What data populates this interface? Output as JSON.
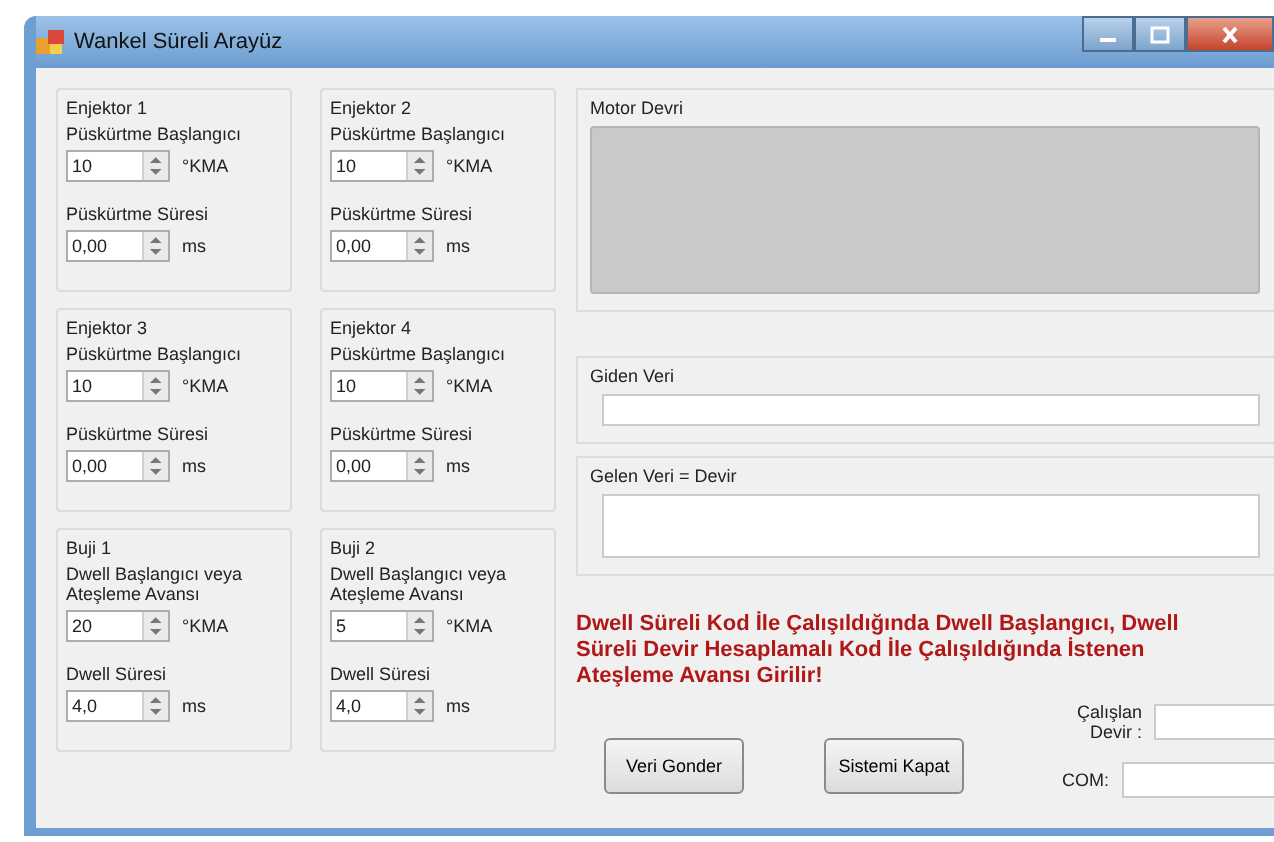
{
  "window": {
    "title": "Wankel Süreli Arayüz"
  },
  "groups": [
    {
      "title": "Enjektor 1",
      "fields": [
        {
          "label": "Püskürtme Başlangıcı",
          "value": "10",
          "unit": "°KMA"
        },
        {
          "label": "Püskürtme Süresi",
          "value": "0,00",
          "unit": "ms"
        }
      ]
    },
    {
      "title": "Enjektor 2",
      "fields": [
        {
          "label": "Püskürtme Başlangıcı",
          "value": "10",
          "unit": "°KMA"
        },
        {
          "label": "Püskürtme Süresi",
          "value": "0,00",
          "unit": "ms"
        }
      ]
    },
    {
      "title": "Enjektor 3",
      "fields": [
        {
          "label": "Püskürtme Başlangıcı",
          "value": "10",
          "unit": "°KMA"
        },
        {
          "label": "Püskürtme Süresi",
          "value": "0,00",
          "unit": "ms"
        }
      ]
    },
    {
      "title": "Enjektor 4",
      "fields": [
        {
          "label": "Püskürtme Başlangıcı",
          "value": "10",
          "unit": "°KMA"
        },
        {
          "label": "Püskürtme Süresi",
          "value": "0,00",
          "unit": "ms"
        }
      ]
    },
    {
      "title": "Buji 1",
      "fields": [
        {
          "label": "Dwell Başlangıcı veya Ateşleme Avansı",
          "value": "20",
          "unit": "°KMA"
        },
        {
          "label": "Dwell Süresi",
          "value": "4,0",
          "unit": "ms"
        }
      ]
    },
    {
      "title": "Buji 2",
      "fields": [
        {
          "label": "Dwell Başlangıcı veya Ateşleme Avansı",
          "value": "5",
          "unit": "°KMA"
        },
        {
          "label": "Dwell Süresi",
          "value": "4,0",
          "unit": "ms"
        }
      ]
    }
  ],
  "motor_devri": {
    "title": "Motor Devri"
  },
  "giden_veri": {
    "title": "Giden Veri"
  },
  "gelen_veri": {
    "title": "Gelen Veri = Devir"
  },
  "note": "Dwell Süreli Kod İle Çalışıldığında Dwell Başlangıcı, Dwell Süreli Devir Hesaplamalı Kod İle Çalışıldığında İstenen Ateşleme Avansı Girilir!",
  "calisan_devir": {
    "label": "Çalışlan Devir :"
  },
  "com": {
    "label": "COM:"
  },
  "buttons": [
    "Veri Gonder",
    "Sistemi Kapat"
  ]
}
